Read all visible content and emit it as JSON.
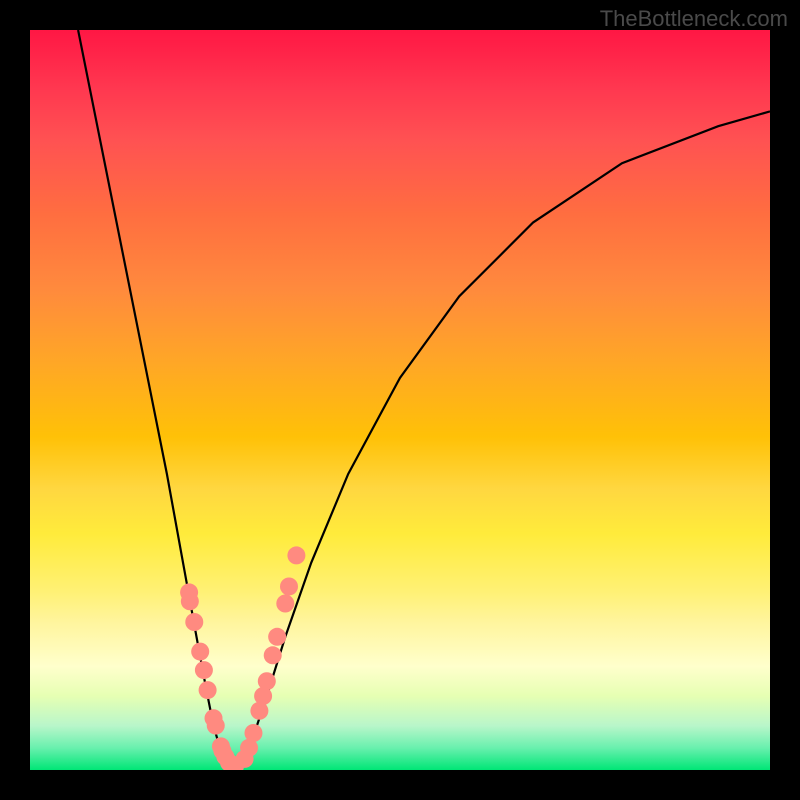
{
  "watermark": "TheBottleneck.com",
  "chart_data": {
    "type": "line",
    "title": "",
    "xlabel": "",
    "ylabel": "",
    "xlim": [
      0,
      1
    ],
    "ylim": [
      0,
      1
    ],
    "curve_left": {
      "x": [
        0.065,
        0.095,
        0.125,
        0.155,
        0.185,
        0.205,
        0.225,
        0.238,
        0.248,
        0.258,
        0.265
      ],
      "y": [
        1.0,
        0.85,
        0.7,
        0.55,
        0.4,
        0.29,
        0.18,
        0.11,
        0.06,
        0.025,
        0.005
      ]
    },
    "curve_right": {
      "x": [
        0.285,
        0.3,
        0.32,
        0.345,
        0.38,
        0.43,
        0.5,
        0.58,
        0.68,
        0.8,
        0.93,
        1.0
      ],
      "y": [
        0.005,
        0.04,
        0.1,
        0.18,
        0.28,
        0.4,
        0.53,
        0.64,
        0.74,
        0.82,
        0.87,
        0.89
      ]
    },
    "scatter_left": {
      "x": [
        0.215,
        0.216,
        0.222,
        0.23,
        0.235,
        0.24,
        0.248,
        0.251,
        0.258,
        0.26,
        0.264,
        0.269,
        0.272,
        0.277
      ],
      "y": [
        0.24,
        0.228,
        0.2,
        0.16,
        0.135,
        0.108,
        0.07,
        0.06,
        0.032,
        0.026,
        0.018,
        0.01,
        0.008,
        0.005
      ]
    },
    "scatter_right": {
      "x": [
        0.29,
        0.296,
        0.302,
        0.31,
        0.315,
        0.32,
        0.328,
        0.334,
        0.345,
        0.35,
        0.36
      ],
      "y": [
        0.015,
        0.03,
        0.05,
        0.08,
        0.1,
        0.12,
        0.155,
        0.18,
        0.225,
        0.248,
        0.29
      ]
    },
    "scatter_color": "#ff8a80",
    "scatter_radius": 9
  }
}
